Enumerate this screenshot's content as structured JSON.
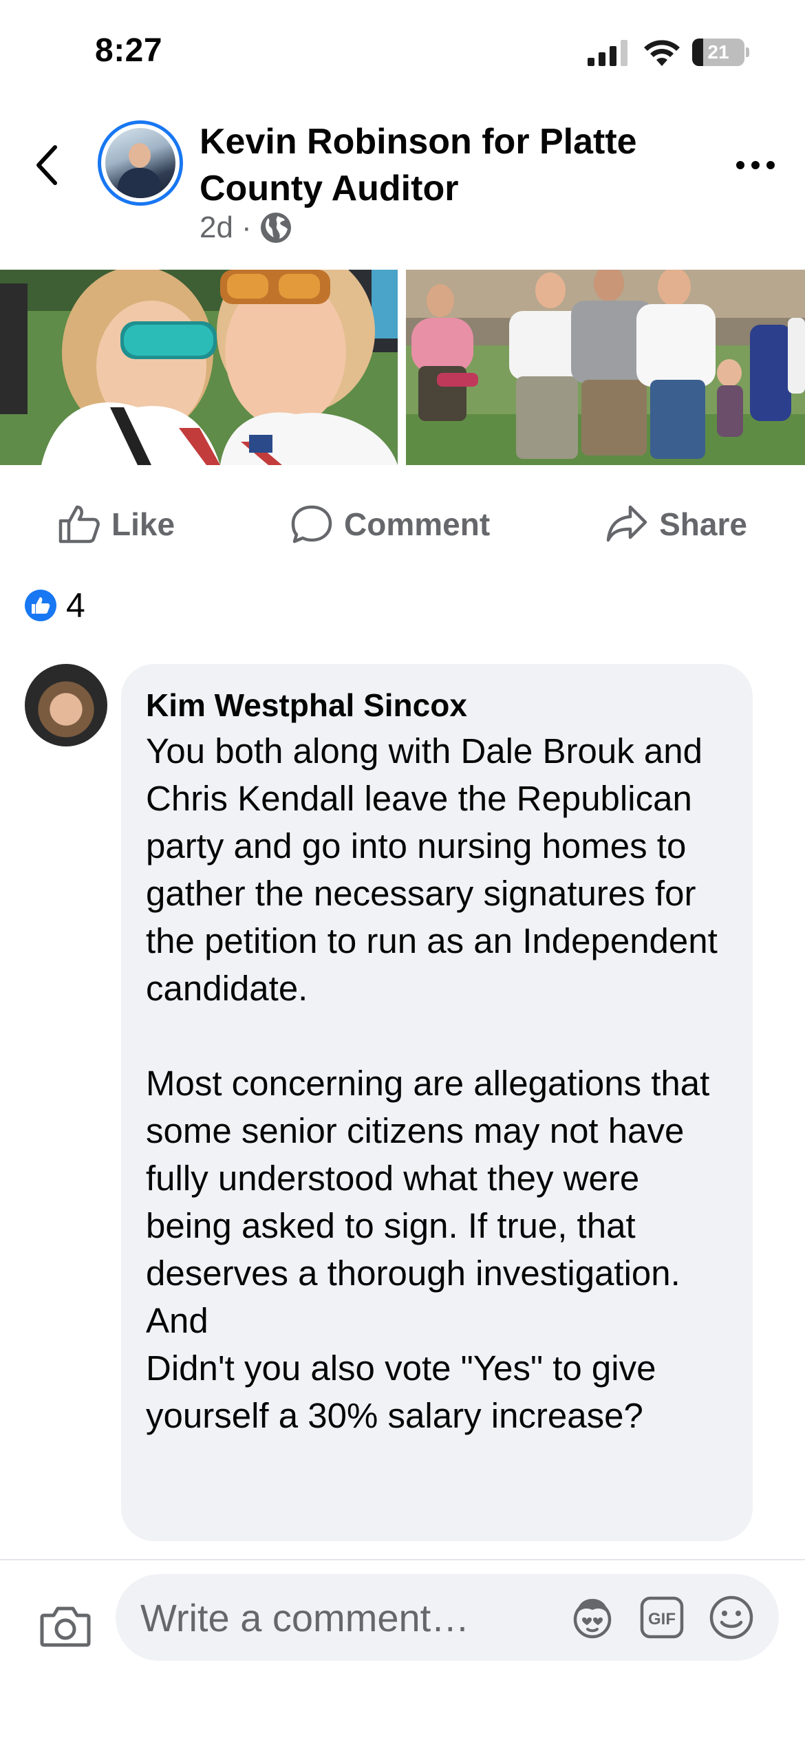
{
  "status_bar": {
    "time": "8:27",
    "battery": "21",
    "battery_level_percent": 21
  },
  "header": {
    "back_icon": "chevron-left-icon",
    "page_name": "Kevin Robinson for Platte County Auditor",
    "timestamp": "2d",
    "separator": "·",
    "audience_icon": "globe-icon",
    "more_icon": "more-horizontal-icon"
  },
  "actions": {
    "like": "Like",
    "comment": "Comment",
    "share": "Share"
  },
  "reactions": {
    "icon": "like-icon",
    "count": "4"
  },
  "comment": {
    "author": "Kim Westphal Sincox",
    "text": "You both along with Dale Brouk and Chris Kendall leave the Republican party and go into nursing homes to gather the necessary signatures for the petition to run as an Independent candidate.\n\nMost concerning are allegations that some senior citizens may not have fully understood what they were being asked to sign. If true, that deserves a thorough investigation.\nAnd\nDidn't you also vote \"Yes\" to give yourself a 30% salary increase?"
  },
  "comment_bar": {
    "placeholder": "Write a comment…",
    "camera_icon": "camera-icon",
    "avatar_sticker_icon": "avatar-sticker-icon",
    "gif_icon": "gif-icon",
    "emoji_icon": "emoji-icon"
  },
  "colors": {
    "brand_blue": "#1877f2",
    "secondary_text": "#65676b",
    "bubble_bg": "#f0f2f5"
  }
}
